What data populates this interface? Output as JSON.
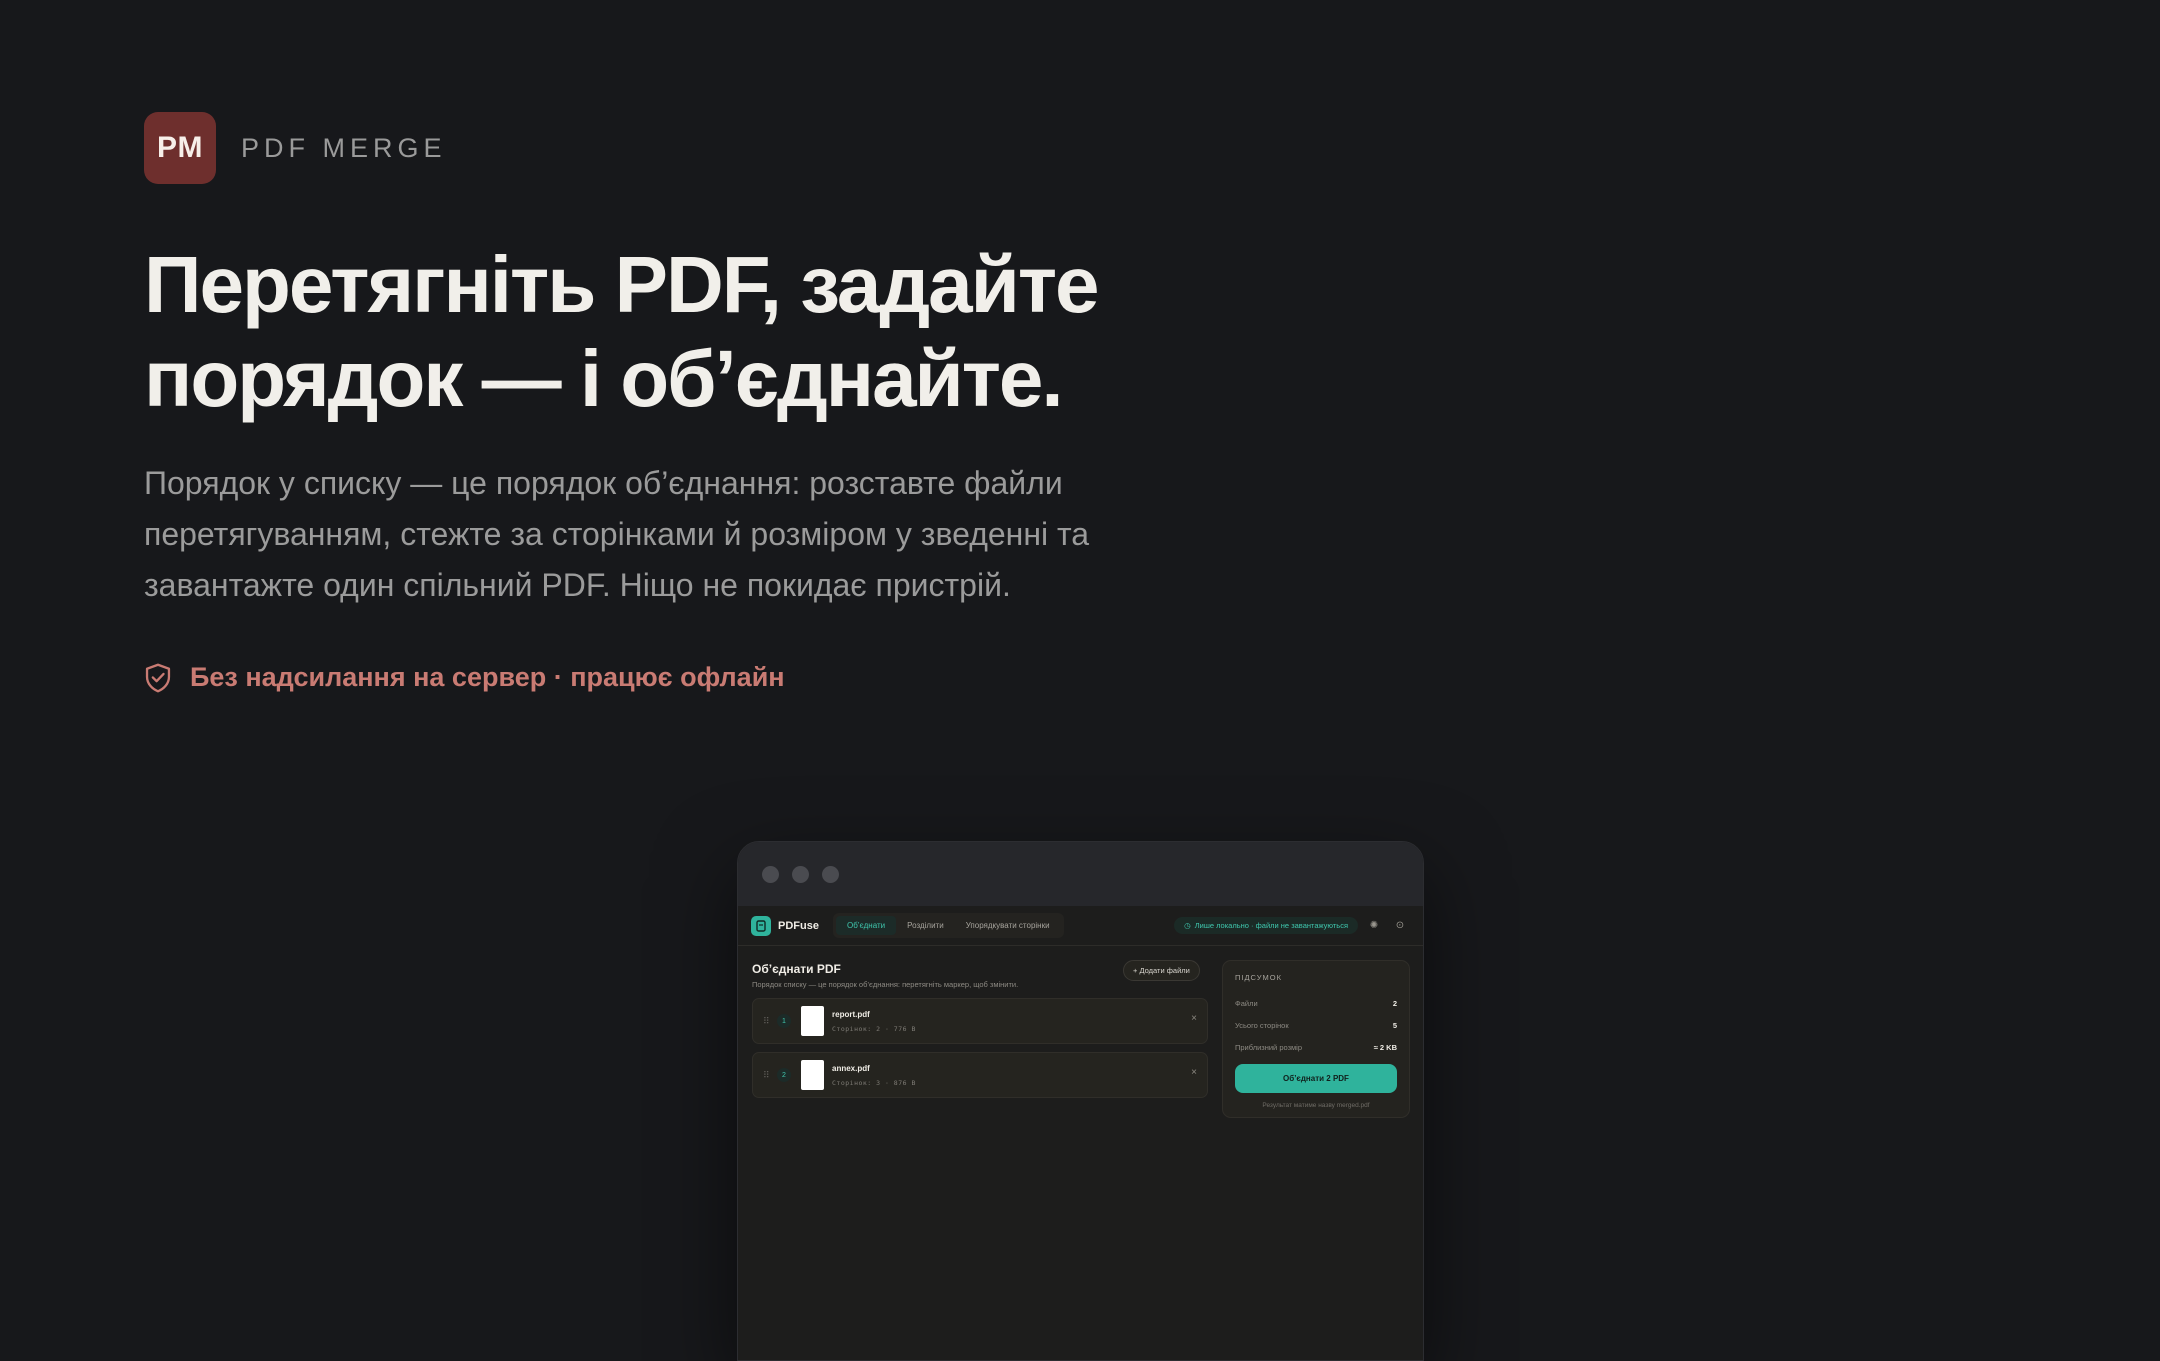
{
  "brand": {
    "logo_text": "PM",
    "name": "PDF MERGE"
  },
  "hero": {
    "headline_line1": "Перетягніть PDF, задайте",
    "headline_line2": "порядок — і об’єднайте.",
    "subtext": "Порядок у списку — це порядок об’єднання: розставте файли перетягуванням, стежте за сторінками й розміром у зведенні та завантажте один спільний PDF. Ніщо не покидає пристрій.",
    "badge": "Без надсилання на сервер · працює офлайн"
  },
  "colors": {
    "background": "#17181b",
    "brand": "#6e2f2d",
    "badge": "#c97b73",
    "accent": "#2fb39c"
  },
  "app": {
    "name": "PDFuse",
    "tabs": [
      {
        "label": "Об’єднати",
        "active": true
      },
      {
        "label": "Розділити",
        "active": false
      },
      {
        "label": "Упорядкувати сторінки",
        "active": false
      }
    ],
    "privacy_note": "Лише локально · файли не завантажуються",
    "icons": [
      "theme-icon",
      "settings-icon"
    ]
  },
  "merge": {
    "title": "Об’єднати PDF",
    "subtitle": "Порядок списку — це порядок об’єднання: перетягніть маркер, щоб змінити.",
    "add_button": "+ Додати файли",
    "files": [
      {
        "index": "1",
        "name": "report.pdf",
        "info": "Сторінок: 2 · 776 B"
      },
      {
        "index": "2",
        "name": "annex.pdf",
        "info": "Сторінок: 3 · 876 B"
      }
    ]
  },
  "summary": {
    "title": "ПІДСУМОК",
    "rows": [
      {
        "label": "Файли",
        "value": "2"
      },
      {
        "label": "Усього сторінок",
        "value": "5"
      },
      {
        "label": "Приблизний розмір",
        "value": "≈ 2 KB"
      }
    ],
    "merge_button": "Об’єднати 2 PDF",
    "result_note": "Результат матиме назву merged.pdf"
  }
}
